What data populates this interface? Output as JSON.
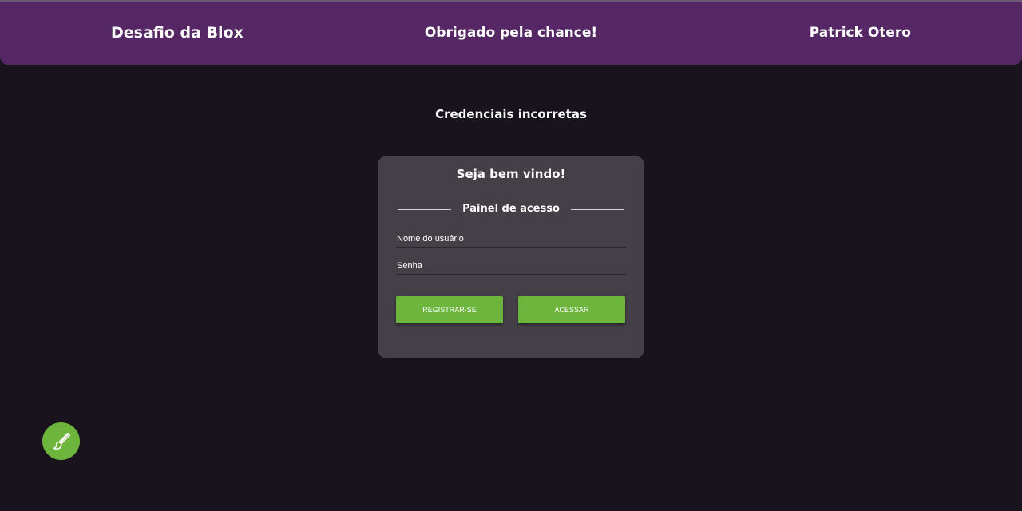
{
  "header": {
    "left_title": "Desafio da Blox",
    "center_title": "Obrigado pela chance!",
    "right_title": "Patrick Otero"
  },
  "alert": {
    "message": "Credenciais incorretas"
  },
  "login_card": {
    "title": "Seja bem vindo!",
    "subtitle": "Painel de acesso",
    "username_placeholder": "Nome do usuário",
    "password_placeholder": "Senha",
    "register_label": "Registrar-se",
    "login_label": "Acessar"
  },
  "fab": {
    "icon": "paintbrush-icon"
  },
  "colors": {
    "background": "#18131c",
    "header": "#552764",
    "card": "#454047",
    "accent_green": "#6db53c"
  }
}
